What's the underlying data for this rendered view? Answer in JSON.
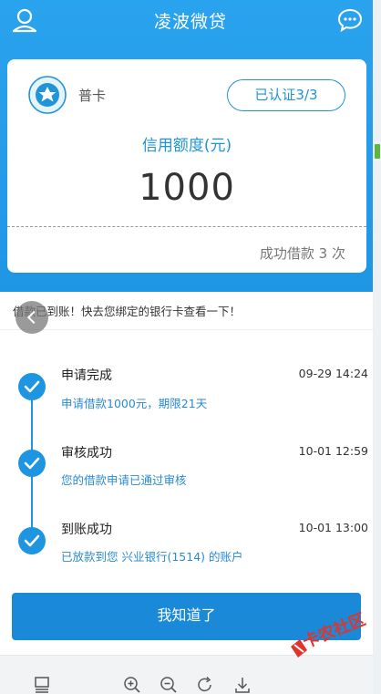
{
  "header": {
    "title": "凌波微贷",
    "user_icon": "user-profile-icon",
    "chat_icon": "chat-bubble-icon"
  },
  "card": {
    "badge_icon": "star-badge-icon",
    "type_label": "普卡",
    "certification": "已认证3/3",
    "credit_label": "信用额度(元)",
    "credit_amount": "1000",
    "success_count": "成功借款 3 次"
  },
  "notice": {
    "text": "借款已到账！快去您绑定的银行卡查看一下！"
  },
  "timeline": [
    {
      "title": "申请完成",
      "time": "09-29 14:24",
      "desc": "申请借款1000元，期限21天"
    },
    {
      "title": "审核成功",
      "time": "10-01 12:59",
      "desc": "您的借款申请已通过审核"
    },
    {
      "title": "到账成功",
      "time": "10-01 13:00",
      "desc": "已放款到您 兴业银行(1514) 的账户"
    }
  ],
  "confirm_button": "我知道了",
  "watermark": "卡农社区",
  "toolbar": {
    "icons": [
      "page-view-icon",
      "zoom-in-icon",
      "zoom-out-icon",
      "rotate-icon",
      "download-icon"
    ]
  },
  "colors": {
    "brand_blue": "#1f96e4",
    "accent_text": "#1f94d8",
    "button_blue": "#1a8ad8",
    "watermark_red": "#e0342c"
  }
}
